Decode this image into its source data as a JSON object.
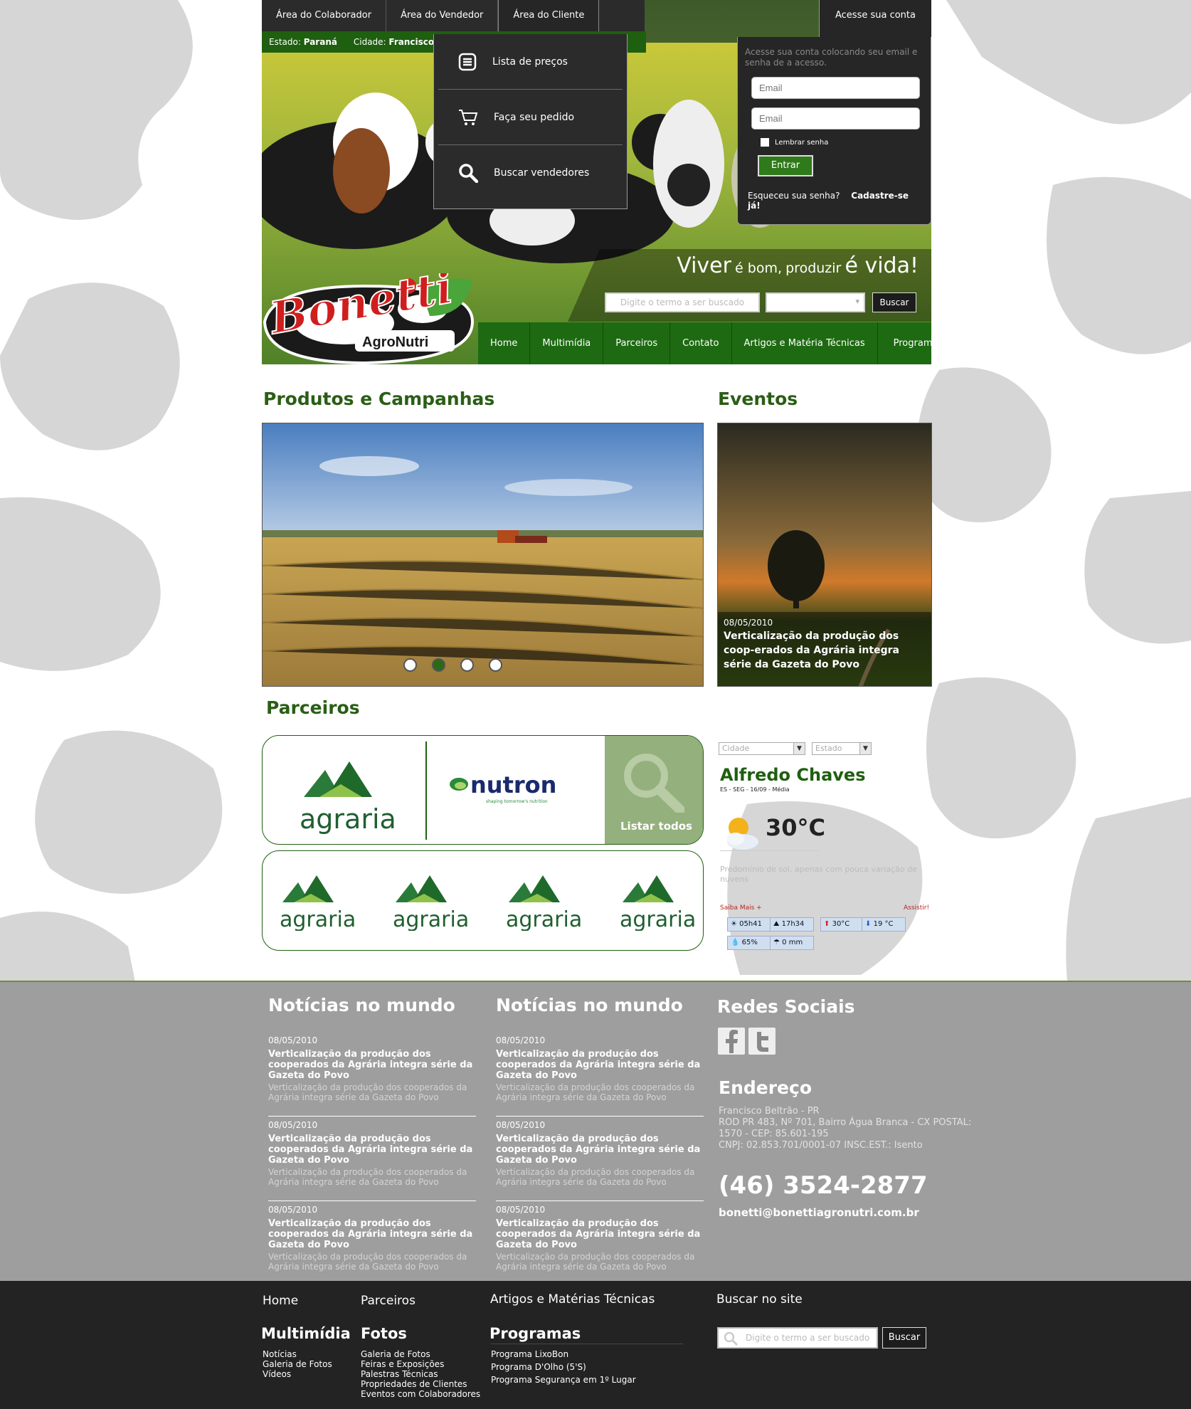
{
  "colors": {
    "brand_green": "#1e6a12",
    "title_green": "#2a5e15",
    "dark": "#262626",
    "footer_grey": "#9e9e9e"
  },
  "topnav": {
    "items": [
      "Área do Colaborador",
      "Área do Vendedor",
      "Área do Cliente"
    ],
    "account": "Acesse sua conta"
  },
  "location": {
    "estado_label": "Estado:",
    "estado": "Paraná",
    "cidade_label": "Cidade:",
    "cidade": "Francisco"
  },
  "dropdown": {
    "items": [
      {
        "label": "Lista de preços",
        "icon": "list-icon"
      },
      {
        "label": "Faça seu pedido",
        "icon": "cart-icon"
      },
      {
        "label": "Buscar vendedores",
        "icon": "search-icon"
      }
    ]
  },
  "login": {
    "intro": "Acesse sua conta colocando seu email e senha de a acesso.",
    "email_placeholder": "Email",
    "password_placeholder": "Email",
    "remember": "Lembrar senha",
    "submit": "Entrar",
    "forgot": "Esqueceu sua senha?",
    "register": "Cadastre-se já!"
  },
  "slogan": {
    "w1": "Viver",
    "w2": "é bom,",
    "w3": "produzir",
    "w4": "é vida!"
  },
  "search": {
    "placeholder": "Digite o termo a ser buscado",
    "button": "Buscar"
  },
  "logo": {
    "brand": "Bonetti",
    "sub": "AgroNutri"
  },
  "mainnav": {
    "items": [
      "Home",
      "Multimídia",
      "Parceiros",
      "Contato",
      "Artigos e Matéria Técnicas",
      "Programas"
    ]
  },
  "sections": {
    "produtos": "Produtos e Campanhas",
    "eventos": "Eventos",
    "parceiros": "Parceiros"
  },
  "carousel": {
    "slides": 4,
    "active": 2
  },
  "evento": {
    "date": "08/05/2010",
    "title": "Verticalização da produção dos coop-erados da Agrária integra série da Gazeta do Povo"
  },
  "partners": {
    "featured": [
      "agraria",
      "nutron"
    ],
    "nutron_tag": "shaping tomorrow's nutrition",
    "list_all": "Listar todos",
    "row": [
      "agraria",
      "agraria",
      "agraria",
      "agraria"
    ]
  },
  "weather": {
    "city_placeholder": "Cidade",
    "state_placeholder": "Estado",
    "city": "Alfredo Chaves",
    "sub": "ES - SEG - 16/09 - Média",
    "temp": "30°C",
    "desc": "Predomínio de sol, apenas com pouca variação de nuvens",
    "more": "Saiba Mais +",
    "watch": "Assistir!",
    "sunrise": "05h41",
    "sunset": "17h34",
    "max": "30°C",
    "min": "19 °C",
    "humidity": "65%",
    "rain": "0 mm"
  },
  "news": {
    "title": "Notícias no mundo",
    "items": [
      {
        "date": "08/05/2010",
        "title": "Verticalização da produção dos cooperados da Agrária integra série da Gazeta do Povo",
        "text": "Verticalização da produção dos cooperados da Agrária integra série da Gazeta do Povo"
      }
    ]
  },
  "social": {
    "title": "Redes Sociais",
    "icons": [
      "facebook-icon",
      "twitter-icon"
    ]
  },
  "address": {
    "title": "Endereço",
    "l1": "Francisco Beltrão - PR",
    "l2": "ROD PR 483, Nº 701, Bairro Água Branca - CX POSTAL:",
    "l3": "1570 - CEP: 85.601-195",
    "l4": "CNPJ: 02.853.701/0001-07 INSC.EST.: Isento",
    "phone": "(46) 3524-2877",
    "email": "bonetti@bonettiagronutri.com.br"
  },
  "footer": {
    "home": "Home",
    "parceiros": "Parceiros",
    "artigos": "Artigos e Matérias Técnicas",
    "buscar": "Buscar no site",
    "multimidia": {
      "title": "Multimídia",
      "items": [
        "Notícias",
        "Galeria de Fotos",
        "Vídeos"
      ]
    },
    "fotos": {
      "title": "Fotos",
      "items": [
        "Galeria de Fotos",
        "Feiras e Exposições",
        "Palestras Técnicas",
        "Propriedades de Clientes",
        "Eventos com Colaboradores"
      ]
    },
    "programas": {
      "title": "Programas",
      "items": [
        "Programa LixoBon",
        "Programa D'Olho (5'S)",
        "Programa Segurança em 1º Lugar"
      ]
    },
    "search_placeholder": "Digite o termo a ser buscado",
    "search_button": "Buscar"
  }
}
